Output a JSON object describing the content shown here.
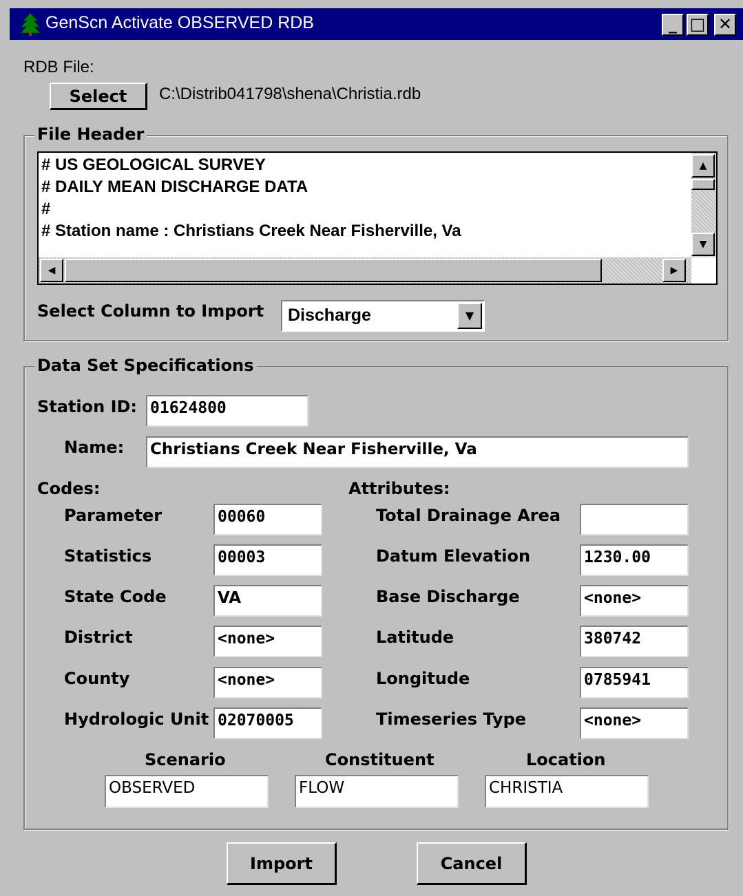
{
  "window": {
    "title": "GenScn Activate OBSERVED RDB",
    "minimize": "_",
    "maximize": "□",
    "close": "✕"
  },
  "rdb": {
    "label": "RDB File:",
    "select_label": "Select",
    "path": "C:\\Distrib041798\\shena\\Christia.rdb"
  },
  "file_header": {
    "label": "File Header",
    "lines": [
      "# US GEOLOGICAL SURVEY",
      "# DAILY MEAN DISCHARGE DATA",
      "#",
      "# Station name  : Christians Creek Near Fisherville, Va"
    ],
    "select_column_label": "Select Column to Import",
    "select_column_value": "Discharge"
  },
  "spec": {
    "label": "Data Set Specifications",
    "station_id_label": "Station ID:",
    "station_id": "01624800",
    "name_label": "Name:",
    "name": "Christians Creek Near Fisherville, Va",
    "codes_label": "Codes:",
    "attributes_label": "Attributes:",
    "codes": [
      {
        "label": "Parameter",
        "value": "00060"
      },
      {
        "label": "Statistics",
        "value": "00003"
      },
      {
        "label": "State Code",
        "value": "VA"
      },
      {
        "label": "District",
        "value": "<none>"
      },
      {
        "label": "County",
        "value": "<none>"
      },
      {
        "label": "Hydrologic Unit",
        "value": "02070005"
      }
    ],
    "attributes": [
      {
        "label": "Total Drainage Area",
        "value": ""
      },
      {
        "label": "Datum Elevation",
        "value": "1230.00"
      },
      {
        "label": "Base Discharge",
        "value": "<none>"
      },
      {
        "label": "Latitude",
        "value": "380742"
      },
      {
        "label": "Longitude",
        "value": "0785941"
      },
      {
        "label": "Timeseries Type",
        "value": "<none>"
      }
    ],
    "scenario_label": "Scenario",
    "scenario": "OBSERVED",
    "constituent_label": "Constituent",
    "constituent": "FLOW",
    "location_label": "Location",
    "location": "CHRISTIA"
  },
  "buttons": {
    "import": "Import",
    "cancel": "Cancel"
  }
}
